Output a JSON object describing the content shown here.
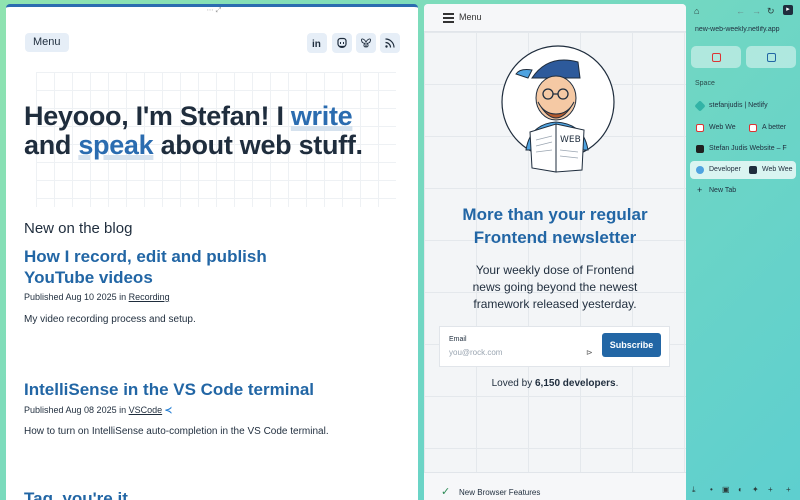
{
  "left": {
    "menu_label": "Menu",
    "social": [
      "linkedin-icon",
      "mastodon-icon",
      "bluesky-icon",
      "rss-icon"
    ],
    "hero": {
      "part1": "Heyooo, I'm Stefan! I ",
      "highlight1": "write",
      "part2": " and ",
      "highlight2": "speak",
      "part3": " about web stuff."
    },
    "blog_heading": "New on the blog",
    "posts": [
      {
        "title": "How I record, edit and publish YouTube videos",
        "meta_prefix": "Published Aug 10 2025 in ",
        "category": "Recording",
        "description": "My video recording process and setup."
      },
      {
        "title": "IntelliSense in the VS Code terminal",
        "meta_prefix": "Published Aug 08 2025 in ",
        "category": "VSCode",
        "description": "How to turn on IntelliSense auto-completion in the VS Code terminal."
      },
      {
        "title": "Tag, you're it"
      }
    ]
  },
  "center": {
    "menu_label": "Menu",
    "newsletter_title": "More than your regular Frontend newsletter",
    "newsletter_desc": "Your weekly dose of Frontend news going beyond the newest framework released yesterday.",
    "email_label": "Email",
    "email_placeholder": "you@rock.com",
    "subscribe_label": "Subscribe",
    "loved_prefix": "Loved by ",
    "loved_count": "6,150 developers",
    "loved_suffix": ".",
    "footer_label": "New Browser Features"
  },
  "sidebar": {
    "url": "new-web-weekly.netlify.app",
    "space_label": "Space",
    "tabs": [
      {
        "label": "stefanjudis | Netlify",
        "icon_color": "#32b3a6"
      },
      {
        "label_a": "Web We",
        "label_b": "A better",
        "split": true
      },
      {
        "label": "Stefan Judis Website – F",
        "icon_color": "#1f1f1f"
      },
      {
        "label_a": "Developer",
        "label_b": "Web Wee",
        "split": true,
        "active": true
      },
      {
        "label": "New Tab",
        "new_tab": true
      }
    ]
  },
  "colors": {
    "accent": "#2266a5",
    "text": "#1f2d3d",
    "sidebar_bg": "#6fd6c4"
  }
}
